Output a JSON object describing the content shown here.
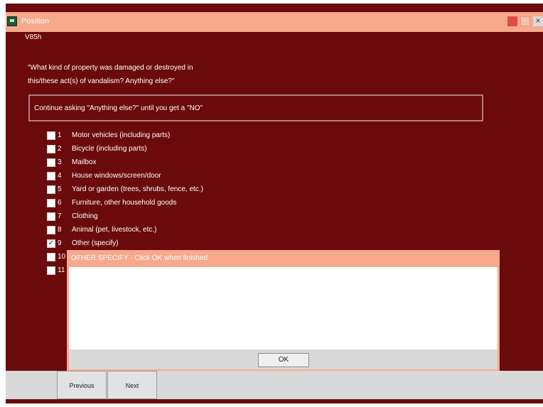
{
  "window": {
    "title": "Position",
    "section_label": "V85h"
  },
  "question": {
    "line1": "\"What kind of property was damaged or destroyed in",
    "line2": "this/these act(s) of vandalism?  Anything else?\""
  },
  "instruction": "Continue asking \"Anything else?\" until you get a \"NO\"",
  "options": [
    {
      "num": "1",
      "label": "Motor vehicles (including parts)",
      "checked": false
    },
    {
      "num": "2",
      "label": "Bicycle (including parts)",
      "checked": false
    },
    {
      "num": "3",
      "label": "Mailbox",
      "checked": false
    },
    {
      "num": "4",
      "label": "House windows/screen/door",
      "checked": false
    },
    {
      "num": "5",
      "label": "Yard or garden (trees, shrubs, fence, etc.)",
      "checked": false
    },
    {
      "num": "6",
      "label": "Furniture, other household goods",
      "checked": false
    },
    {
      "num": "7",
      "label": "Clothing",
      "checked": false
    },
    {
      "num": "8",
      "label": "Animal (pet, livestock, etc.)",
      "checked": false
    },
    {
      "num": "9",
      "label": "Other (specify)",
      "checked": true
    },
    {
      "num": "10",
      "label": "",
      "checked": false
    },
    {
      "num": "11",
      "label": "",
      "checked": false
    }
  ],
  "dialog": {
    "title": "OTHER SPECIFY  -  Click OK when finished",
    "ok_label": "OK",
    "text_value": ""
  },
  "nav": {
    "previous_label": "Previous",
    "next_label": "Next"
  }
}
